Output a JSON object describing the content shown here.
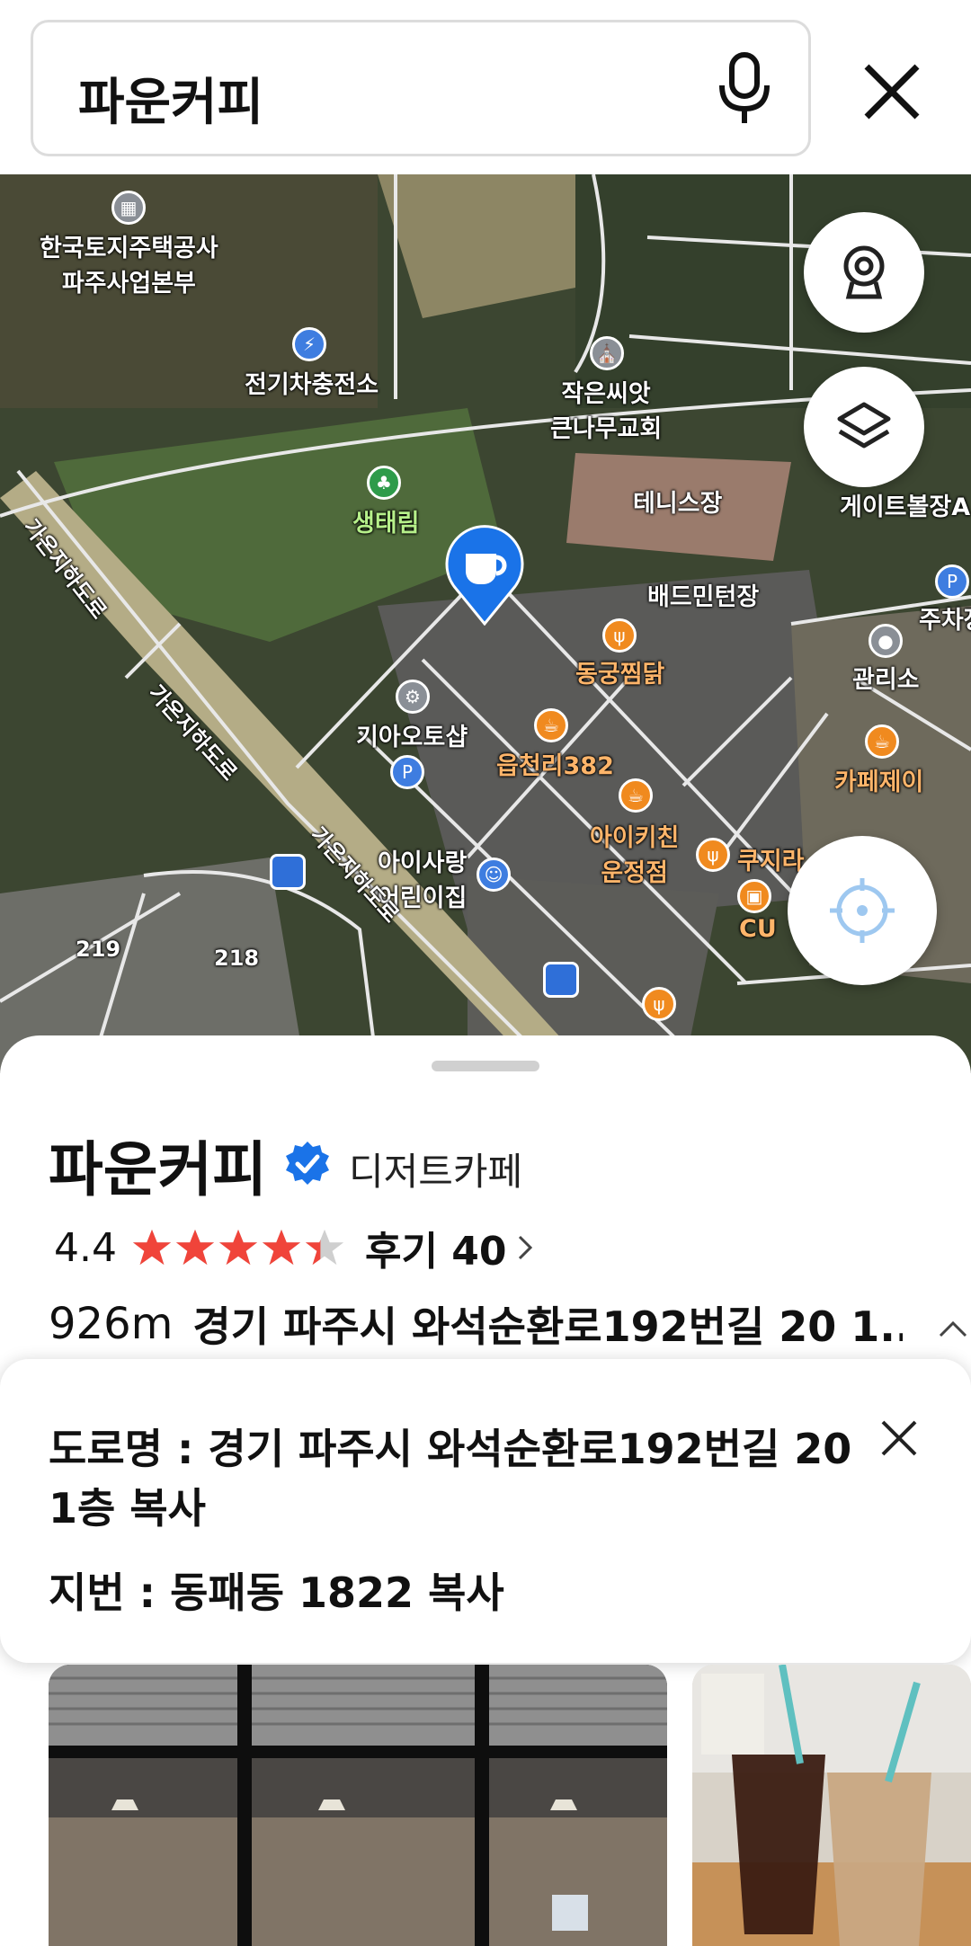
{
  "search": {
    "query": "파운커피",
    "mic_icon": "microphone-icon",
    "close_icon": "close-icon"
  },
  "map": {
    "labels": {
      "lh": "한국토지주택공사\n파주사업본부",
      "ev": "전기차충전소",
      "church": "작은씨앗\n큰나무교회",
      "tennis": "테니스장",
      "gate": "게이트볼장A",
      "eco": "생태림",
      "badminton": "배드민턴장",
      "parking": "주차장",
      "manage": "관리소",
      "donggung": "동궁찜닭",
      "kia": "기아오토샵",
      "eupcheon": "읍천리382",
      "cafe_j": "카페제이",
      "aikitchen": "아이키친\n운정점",
      "kuji": "쿠지라",
      "cu": "CU",
      "kids": "아이사랑\n어린이집",
      "road1": "가온지하도로",
      "road2": "가온지하도로",
      "road3": "가온지하도로",
      "bld219": "219",
      "bld218": "218"
    },
    "buttons": {
      "cctv": "cctv-icon",
      "layers": "layers-icon",
      "locate": "locate-icon"
    }
  },
  "place": {
    "name": "파운커피",
    "category": "디저트카페",
    "rating": "4.4",
    "rating_value": 4.4,
    "rating_max": 5,
    "reviews": "후기 40",
    "distance": "926m",
    "address_short": "경기 파주시 와석순환로192번길 20 1..."
  },
  "address_popup": {
    "road_line1": "도로명 : 경기 파주시 와석순환로192번길 20",
    "road_line2": "1층 복사",
    "lot": "지번 : 동패동 1822 복사"
  },
  "colors": {
    "accent_blue": "#1a73e8",
    "star": "#f0443a"
  }
}
